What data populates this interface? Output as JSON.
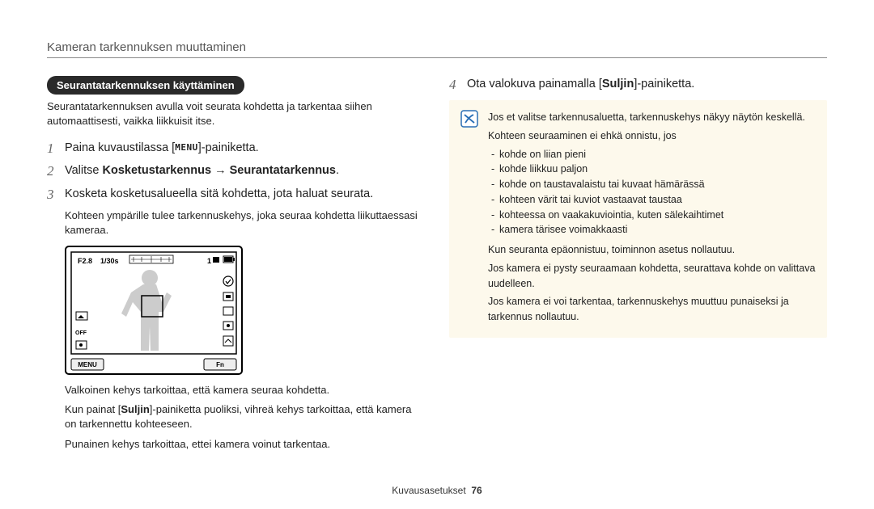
{
  "header": "Kameran tarkennuksen muuttaminen",
  "left": {
    "pill": "Seurantatarkennuksen käyttäminen",
    "intro": "Seurantatarkennuksen avulla voit seurata kohdetta ja tarkentaa siihen automaattisesti, vaikka liikkuisit itse.",
    "step1": {
      "num": "1",
      "text_a": "Paina kuvaustilassa [",
      "menu": "MENU",
      "text_b": "]-painiketta."
    },
    "step2": {
      "num": "2",
      "prefix": "Valitse ",
      "bold1": "Kosketustarkennus",
      "arrow": " → ",
      "bold2": "Seurantatarkennus",
      "suffix": "."
    },
    "step3": {
      "num": "3",
      "text": "Kosketa kosketusalueella sitä kohdetta, jota haluat seurata."
    },
    "sub3": "Kohteen ympärille tulee tarkennuskehys, joka seuraa kohdetta liikuttaessasi kameraa.",
    "screen": {
      "tl1": "F2.8",
      "tl2": "1/30s",
      "menu_btn": "MENU",
      "fn_btn": "Fn"
    },
    "note1": "Valkoinen kehys tarkoittaa, että kamera seuraa kohdetta.",
    "note2_a": "Kun painat [",
    "note2_bold": "Suljin",
    "note2_b": "]-painiketta puoliksi, vihreä kehys tarkoittaa, että kamera on tarkennettu kohteeseen.",
    "note3": "Punainen kehys tarkoittaa, ettei kamera voinut tarkentaa."
  },
  "right": {
    "step4": {
      "num": "4",
      "prefix": "Ota valokuva painamalla [",
      "bold": "Suljin",
      "suffix": "]-painiketta."
    },
    "info": {
      "p1": "Jos et valitse tarkennusaluetta, tarkennuskehys näkyy näytön keskellä.",
      "p2": "Kohteen seuraaminen ei ehkä onnistu, jos",
      "bullets": [
        "kohde on liian pieni",
        "kohde liikkuu paljon",
        "kohde on taustavalaistu tai kuvaat hämärässä",
        "kohteen värit tai kuviot vastaavat taustaa",
        "kohteessa on vaakakuviointia, kuten sälekaihtimet",
        "kamera tärisee voimakkaasti"
      ],
      "p3": "Kun seuranta epäonnistuu, toiminnon asetus nollautuu.",
      "p4": "Jos kamera ei pysty seuraamaan kohdetta, seurattava kohde on valittava uudelleen.",
      "p5": "Jos kamera ei voi tarkentaa, tarkennuskehys muuttuu punaiseksi ja tarkennus nollautuu."
    }
  },
  "footer": {
    "label": "Kuvausasetukset",
    "page": "76"
  }
}
